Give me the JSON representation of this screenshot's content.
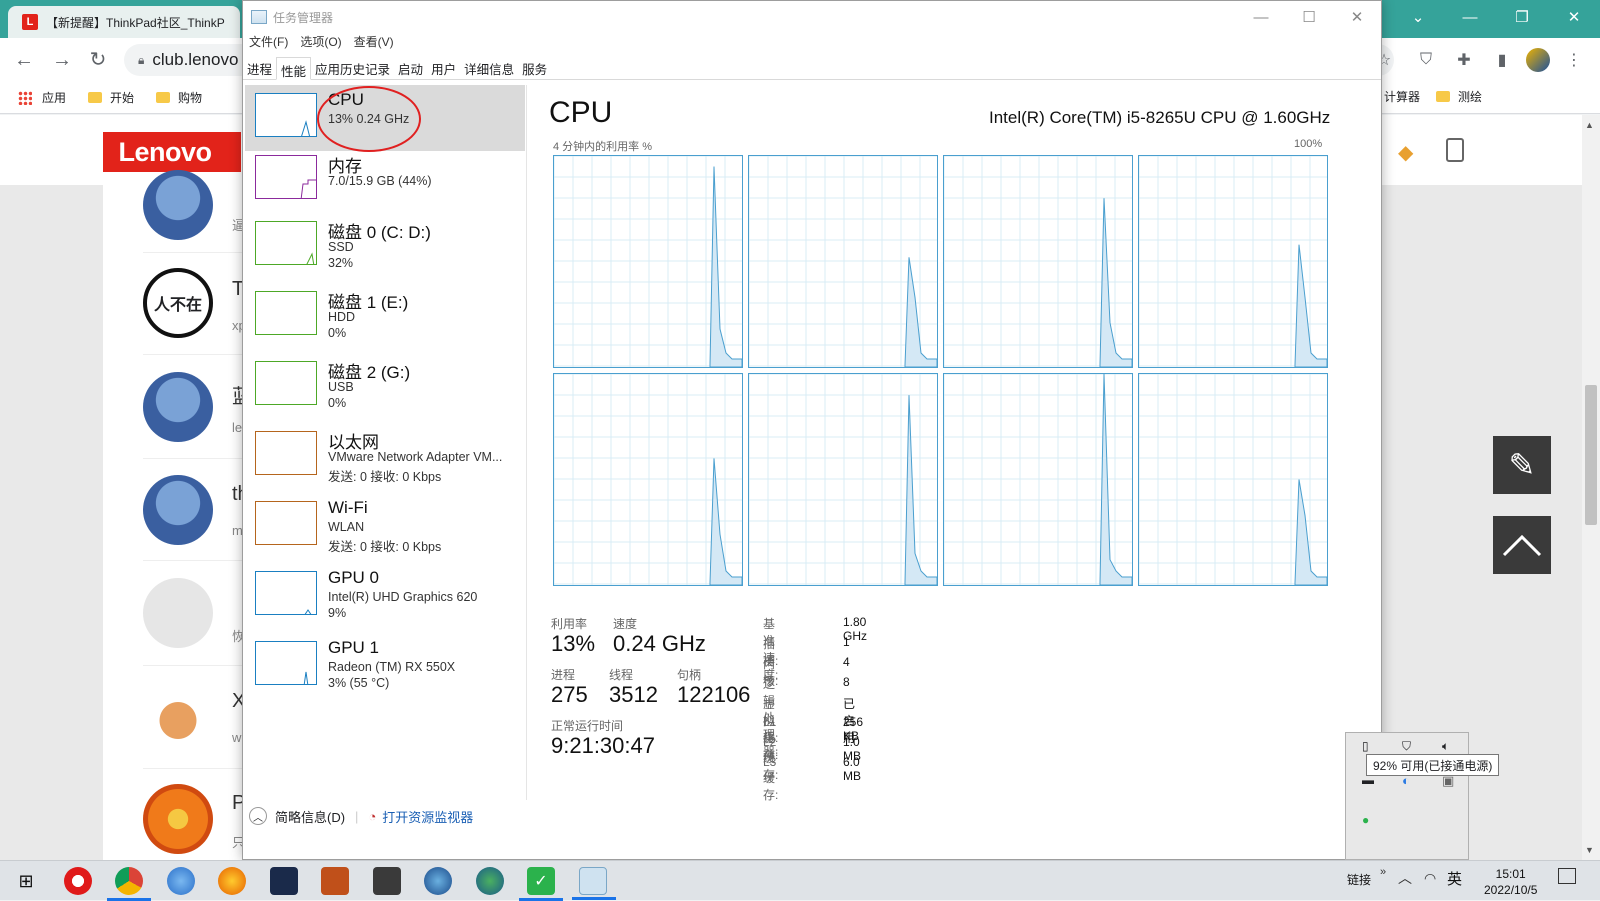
{
  "browser": {
    "tab_title": "【新提醒】ThinkPad社区_ThinkP",
    "tab_favicon": "L",
    "url": "club.lenovo",
    "bookmarks": [
      "应用",
      "开始",
      "购物"
    ],
    "bookmarks_right": [
      "计算器",
      "测绘"
    ]
  },
  "site": {
    "logo": "Lenovo",
    "list": [
      {
        "name": "T",
        "sub": "xp"
      },
      {
        "name": "蓝",
        "sub": "le"
      },
      {
        "name": "th",
        "sub": "m"
      },
      {
        "name": "",
        "sub": "恢"
      },
      {
        "name": "X",
        "sub": "w"
      },
      {
        "name": "P",
        "sub": "只"
      }
    ],
    "badge_text": "人不在"
  },
  "taskmgr": {
    "title": "任务管理器",
    "menu": [
      "文件(F)",
      "选项(O)",
      "查看(V)"
    ],
    "tabs": [
      "进程",
      "性能",
      "应用历史记录",
      "启动",
      "用户",
      "详细信息",
      "服务"
    ],
    "active_tab": "性能",
    "resources": [
      {
        "title": "CPU",
        "lines": [
          "13% 0.24 GHz"
        ],
        "color": "#1a7fc1"
      },
      {
        "title": "内存",
        "lines": [
          "7.0/15.9 GB (44%)"
        ],
        "color": "#8b2a9c"
      },
      {
        "title": "磁盘 0 (C: D:)",
        "lines": [
          "SSD",
          "32%"
        ],
        "color": "#4da826"
      },
      {
        "title": "磁盘 1 (E:)",
        "lines": [
          "HDD",
          "0%"
        ],
        "color": "#4da826"
      },
      {
        "title": "磁盘 2 (G:)",
        "lines": [
          "USB",
          "0%"
        ],
        "color": "#4da826"
      },
      {
        "title": "以太网",
        "lines": [
          "VMware Network Adapter VM...",
          "发送: 0 接收: 0 Kbps"
        ],
        "color": "#b5651d"
      },
      {
        "title": "Wi-Fi",
        "lines": [
          "WLAN",
          "发送: 0 接收: 0 Kbps"
        ],
        "color": "#b5651d"
      },
      {
        "title": "GPU 0",
        "lines": [
          "Intel(R) UHD Graphics 620",
          "9%"
        ],
        "color": "#1a7fc1"
      },
      {
        "title": "GPU 1",
        "lines": [
          "Radeon (TM) RX 550X",
          "3% (55 °C)"
        ],
        "color": "#1a7fc1"
      }
    ],
    "main": {
      "heading": "CPU",
      "model": "Intel(R) Core(TM) i5-8265U CPU @ 1.60GHz",
      "graph_label": "4 分钟内的利用率 %",
      "graph_max": "100%",
      "stats": {
        "util_label": "利用率",
        "util": "13%",
        "speed_label": "速度",
        "speed": "0.24 GHz",
        "proc_label": "进程",
        "proc": "275",
        "threads_label": "线程",
        "threads": "3512",
        "handles_label": "句柄",
        "handles": "122106",
        "uptime_label": "正常运行时间",
        "uptime": "9:21:30:47"
      },
      "details": [
        [
          "基准速度:",
          "1.80 GHz"
        ],
        [
          "插槽:",
          "1"
        ],
        [
          "内核:",
          "4"
        ],
        [
          "逻辑处理器:",
          "8"
        ],
        [
          "虚拟化:",
          "已启用"
        ],
        [
          "L1 缓存:",
          "256 KB"
        ],
        [
          "L2 缓存:",
          "1.0 MB"
        ],
        [
          "L3 缓存:",
          "6.0 MB"
        ]
      ]
    },
    "footer": {
      "brief": "简略信息(D)",
      "monitor": "打开资源监视器"
    }
  },
  "tray": {
    "tooltip": "92% 可用(已接通电源)",
    "link_label": "链接",
    "ime": "英",
    "time": "15:01",
    "date": "2022/10/5"
  },
  "colors": {
    "accent": "#1a7fc1",
    "browser_teal": "#35a39a",
    "lenovo_red": "#e2231a",
    "graph_line": "#4a9fcf"
  }
}
